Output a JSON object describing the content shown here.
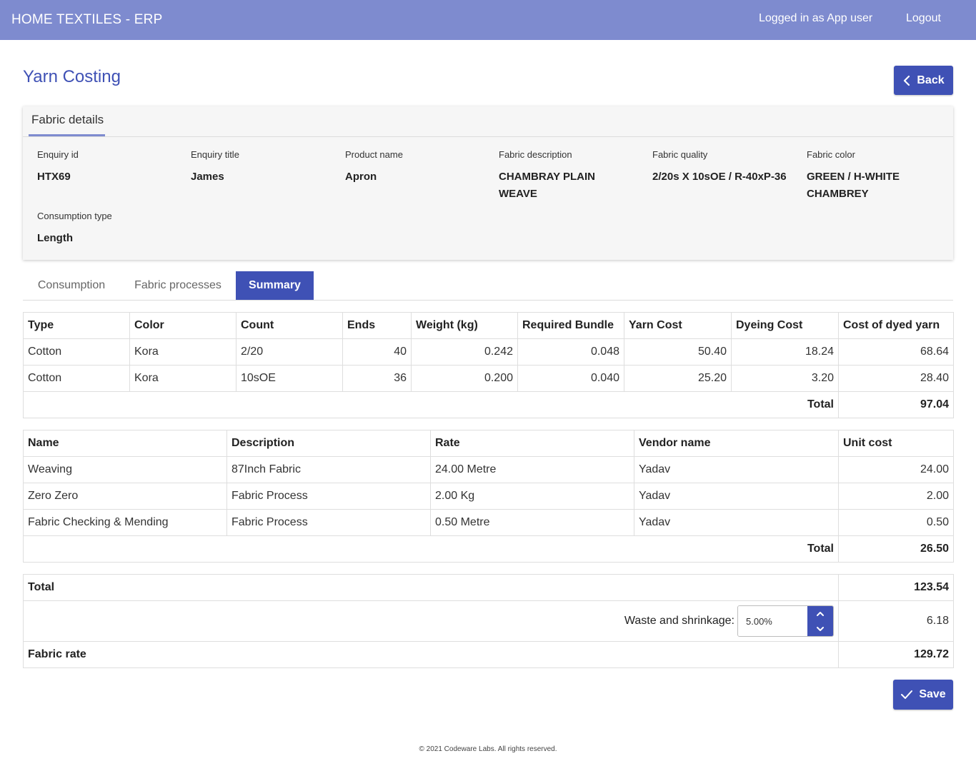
{
  "header": {
    "brand": "HOME TEXTILES - ERP",
    "user": "Logged in as App user",
    "logout": "Logout"
  },
  "page": {
    "title": "Yarn Costing",
    "back_label": "Back",
    "save_label": "Save"
  },
  "fabric_details": {
    "tab_label": "Fabric details",
    "enquiry_id": {
      "label": "Enquiry id",
      "value": "HTX69"
    },
    "enquiry_title": {
      "label": "Enquiry title",
      "value": "James"
    },
    "product_name": {
      "label": "Product name",
      "value": "Apron"
    },
    "fabric_description": {
      "label": "Fabric description",
      "value": "CHAMBRAY PLAIN WEAVE"
    },
    "fabric_quality": {
      "label": "Fabric quality",
      "value": "2/20s X 10sOE / R-40xP-36"
    },
    "fabric_color": {
      "label": "Fabric color",
      "value": "GREEN / H-WHITE CHAMBREY"
    },
    "consumption_type": {
      "label": "Consumption type",
      "value": "Length"
    }
  },
  "tabs": [
    "Consumption",
    "Fabric processes",
    "Summary"
  ],
  "yarn_table": {
    "headers": [
      "Type",
      "Color",
      "Count",
      "Ends",
      "Weight (kg)",
      "Required Bundle",
      "Yarn Cost",
      "Dyeing Cost",
      "Cost of dyed yarn"
    ],
    "rows": [
      [
        "Cotton",
        "Kora",
        "2/20",
        "40",
        "0.242",
        "0.048",
        "50.40",
        "18.24",
        "68.64"
      ],
      [
        "Cotton",
        "Kora",
        "10sOE",
        "36",
        "0.200",
        "0.040",
        "25.20",
        "3.20",
        "28.40"
      ]
    ],
    "total_label": "Total",
    "total_value": "97.04"
  },
  "process_table": {
    "headers": [
      "Name",
      "Description",
      "Rate",
      "Vendor name",
      "Unit cost"
    ],
    "rows": [
      [
        "Weaving",
        "87Inch Fabric",
        "24.00 Metre",
        "Yadav",
        "24.00"
      ],
      [
        "Zero Zero",
        "Fabric Process",
        "2.00 Kg",
        "Yadav",
        "2.00"
      ],
      [
        "Fabric Checking & Mending",
        "Fabric Process",
        "0.50 Metre",
        "Yadav",
        "0.50"
      ]
    ],
    "total_label": "Total",
    "total_value": "26.50"
  },
  "summary": {
    "total_label": "Total",
    "total_value": "123.54",
    "waste_label": "Waste and shrinkage:",
    "waste_input": "5.00%",
    "waste_value": "6.18",
    "fabric_rate_label": "Fabric rate",
    "fabric_rate_value": "129.72"
  },
  "footer": "© 2021 Codeware Labs. All rights reserved.",
  "colors": {
    "primary": "#3f51b5",
    "topbar": "#7e8bcf"
  },
  "icons": {
    "back": "chevron-left-icon",
    "save": "check-icon",
    "up": "chevron-up-icon",
    "down": "chevron-down-icon"
  }
}
